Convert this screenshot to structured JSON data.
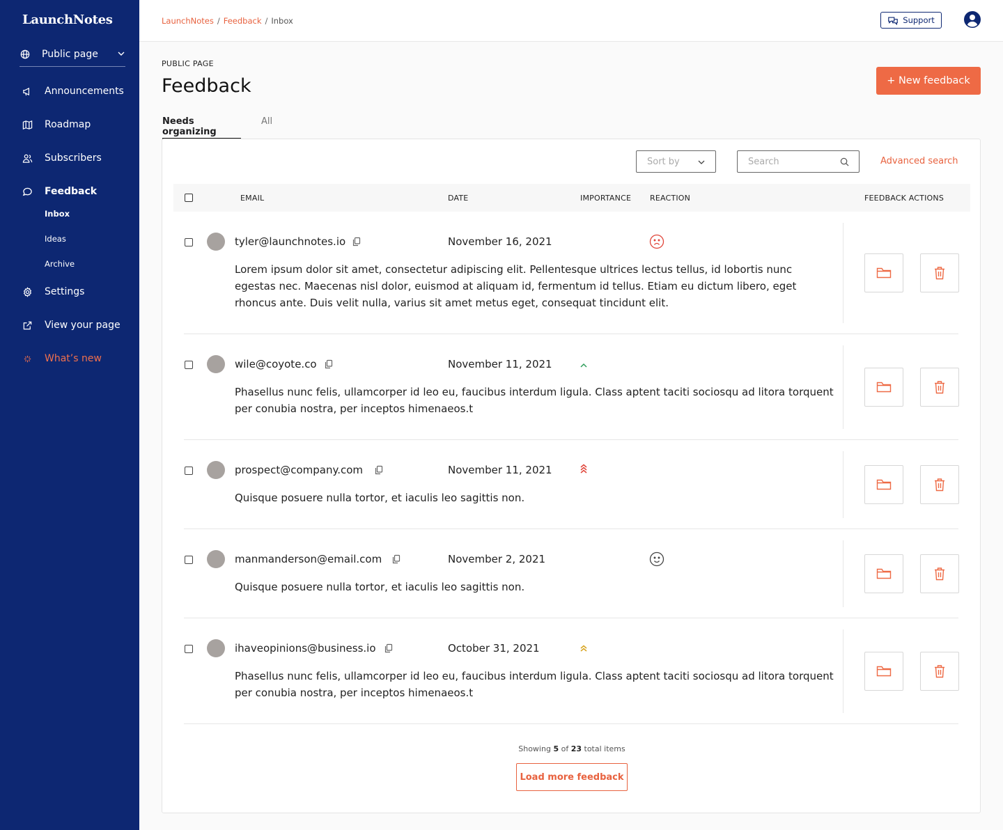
{
  "app": {
    "name": "LaunchNotes"
  },
  "sidebar": {
    "page_selector": "Public page",
    "items": [
      {
        "label": "Announcements",
        "icon": "megaphone-icon"
      },
      {
        "label": "Roadmap",
        "icon": "map-icon"
      },
      {
        "label": "Subscribers",
        "icon": "users-icon"
      },
      {
        "label": "Feedback",
        "icon": "chat-icon"
      },
      {
        "label": "Settings",
        "icon": "gear-icon"
      },
      {
        "label": "View your page",
        "icon": "external-link-icon"
      },
      {
        "label": "What’s new",
        "icon": "sparkle-icon"
      }
    ],
    "feedback_sub": [
      "Inbox",
      "Ideas",
      "Archive"
    ]
  },
  "topbar": {
    "breadcrumb": [
      "LaunchNotes",
      "Feedback",
      "Inbox"
    ],
    "support_label": "Support"
  },
  "header": {
    "eyebrow": "PUBLIC PAGE",
    "title": "Feedback",
    "new_button": "+ New feedback",
    "tabs": [
      "Needs organizing",
      "All"
    ]
  },
  "toolbar": {
    "sort_placeholder": "Sort by",
    "search_placeholder": "Search",
    "advanced_search": "Advanced search"
  },
  "table": {
    "columns": [
      "EMAIL",
      "DATE",
      "IMPORTANCE",
      "REACTION",
      "FEEDBACK ACTIONS"
    ],
    "rows": [
      {
        "email": "tyler@launchnotes.io",
        "date": "November 16, 2021",
        "importance": "",
        "reaction": "sad",
        "body": "Lorem ipsum dolor sit amet, consectetur adipiscing elit. Pellentesque ultrices lectus tellus, id lobortis nunc egestas nec. Maecenas nisl dolor, euismod at aliquam id, fermentum id tellus. Etiam eu dictum libero, eget rhoncus ante. Duis velit nulla, varius sit amet metus eget, consequat tincidunt elit."
      },
      {
        "email": "wile@coyote.co",
        "date": "November 11, 2021",
        "importance": "low",
        "reaction": "",
        "body": "Phasellus nunc felis, ullamcorper id leo eu, faucibus interdum ligula. Class aptent taciti sociosqu ad litora torquent per conubia nostra, per inceptos himenaeos.t"
      },
      {
        "email": "prospect@company.com",
        "date": "November 11, 2021",
        "importance": "high",
        "reaction": "",
        "body": "Quisque posuere nulla tortor, et iaculis leo sagittis non."
      },
      {
        "email": "manmanderson@email.com",
        "date": "November 2, 2021",
        "importance": "",
        "reaction": "happy",
        "body": "Quisque posuere nulla tortor, et iaculis leo sagittis non."
      },
      {
        "email": "ihaveopinions@business.io",
        "date": "October 31, 2021",
        "importance": "medium",
        "reaction": "",
        "body": "Phasellus nunc felis, ullamcorper id leo eu, faucibus interdum ligula. Class aptent taciti sociosqu ad litora torquent per conubia nostra, per inceptos himenaeos.t"
      }
    ]
  },
  "footer": {
    "showing_prefix": "Showing",
    "shown": "5",
    "of_word": "of",
    "total": "23",
    "suffix": "total items",
    "load_more": "Load more feedback"
  },
  "colors": {
    "sidebar_bg": "#0d2772",
    "accent": "#ee6a45",
    "importance_low": "#2e9e5b",
    "importance_high": "#e0453a",
    "importance_medium": "#d8a521"
  }
}
